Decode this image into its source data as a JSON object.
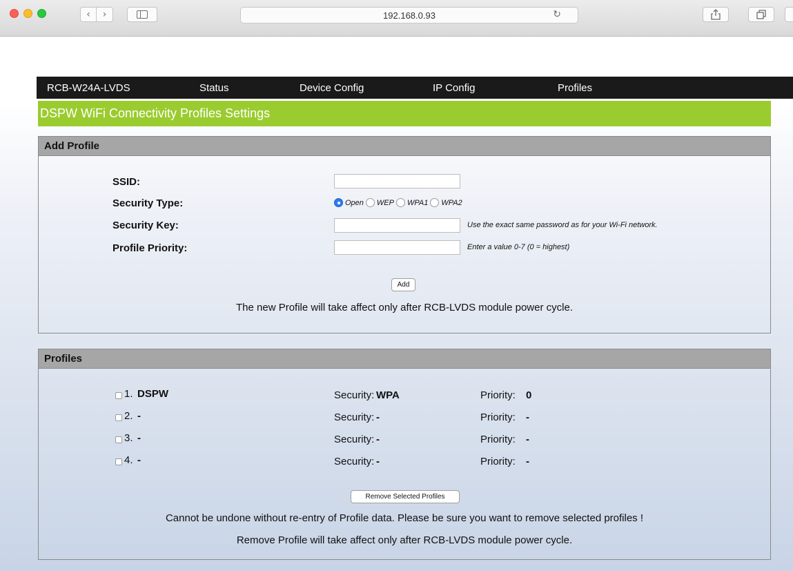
{
  "browser": {
    "url": "192.168.0.93",
    "icons": [
      "back-chevron-icon",
      "forward-chevron-icon",
      "sidebar-icon",
      "reload-icon",
      "share-icon",
      "tabs-icon"
    ]
  },
  "menu": {
    "items": [
      "RCB-W24A-LVDS",
      "Status",
      "Device Config",
      "IP Config",
      "Profiles"
    ]
  },
  "page_title": "DSPW WiFi Connectivity Profiles Settings",
  "add_profile": {
    "header": "Add Profile",
    "ssid_label": "SSID:",
    "ssid_value": "",
    "security_type_label": "Security Type:",
    "security_options": [
      "Open",
      "WEP",
      "WPA1",
      "WPA2"
    ],
    "security_selected": "Open",
    "security_key_label": "Security Key:",
    "security_key_value": "",
    "security_key_hint": "Use the exact same password as for your Wi-Fi network.",
    "priority_label": "Profile Priority:",
    "priority_value": "",
    "priority_hint": "Enter a value 0-7 (0 = highest)",
    "add_button": "Add",
    "note": "The new Profile will take affect only after RCB-LVDS module power cycle."
  },
  "profiles": {
    "header": "Profiles",
    "security_prefix": "Security: ",
    "priority_prefix": "Priority: ",
    "rows": [
      {
        "index": "1.",
        "name": "DSPW",
        "security": "WPA",
        "priority": "0"
      },
      {
        "index": "2.",
        "name": "-",
        "security": "-",
        "priority": "-"
      },
      {
        "index": "3.",
        "name": "-",
        "security": "-",
        "priority": "-"
      },
      {
        "index": "4.",
        "name": "-",
        "security": "-",
        "priority": "-"
      }
    ],
    "remove_button": "Remove Selected Profiles",
    "warning": "Cannot be undone without re-entry of Profile data. Please be sure you want to remove selected profiles !",
    "note": "Remove Profile will take affect only after RCB-LVDS module power cycle."
  }
}
